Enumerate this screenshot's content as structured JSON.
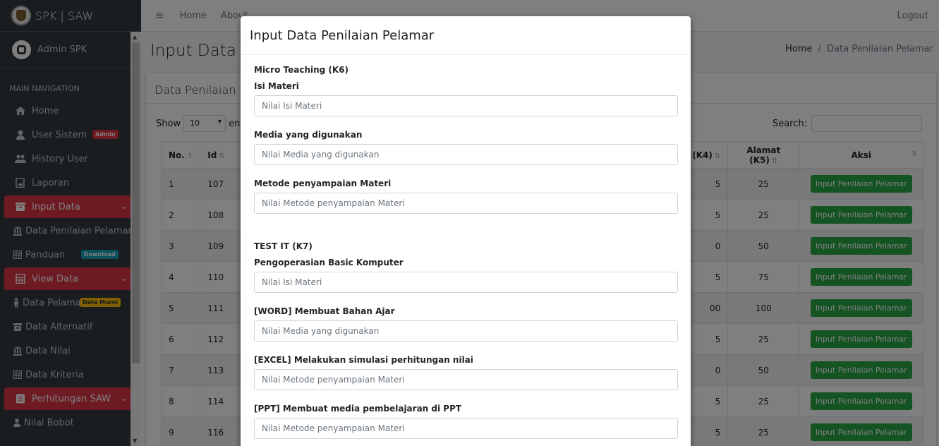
{
  "brand": "SPK | SAW",
  "user": "Admin SPK",
  "nav_header": "MAIN NAVIGATION",
  "nav": {
    "home": "Home",
    "user_sistem": "User Sistem",
    "user_sistem_badge": "Admin",
    "history_user": "History User",
    "laporan": "Laporan",
    "input_data": "Input Data",
    "data_penilaian": "Data Penilaian Pelamar",
    "panduan": "Panduan",
    "panduan_badge": "Download",
    "view_data": "View Data",
    "data_pelamar": "Data Pelamar",
    "data_pelamar_badge": "Data Murni",
    "data_alternatif": "Data Alternatif",
    "data_nilai": "Data Nilai",
    "data_kriteria": "Data Kriteria",
    "perhitungan": "Perhitungan SAW",
    "nilai_bobot": "Nilai Bobot"
  },
  "topnav": {
    "home": "Home",
    "about": "About",
    "logout": "Logout"
  },
  "page": {
    "title": "Input Data",
    "breadcrumb_home": "Home",
    "breadcrumb_sep": "/",
    "breadcrumb_current": "Data Penilaian Pelamar",
    "card_title": "Data Penilaian Pelamar",
    "show_label": "Show",
    "show_value": "10",
    "entries_label": "entries",
    "search_label": "Search:"
  },
  "table": {
    "headers": {
      "no": "No.",
      "id": "Id",
      "k4": "(K4)",
      "k5": "Alamat (K5)",
      "aksi": "Aksi"
    },
    "rows": [
      {
        "no": "1",
        "id": "107",
        "k4": "5",
        "k5": "25",
        "aksi": "Input Penilaian Pelamar"
      },
      {
        "no": "2",
        "id": "108",
        "k4": "5",
        "k5": "25",
        "aksi": "Input Penilaian Pelamar"
      },
      {
        "no": "3",
        "id": "109",
        "k4": "0",
        "k5": "50",
        "aksi": "Input Penilaian Pelamar"
      },
      {
        "no": "4",
        "id": "110",
        "k4": "5",
        "k5": "75",
        "aksi": "Input Penilaian Pelamar"
      },
      {
        "no": "5",
        "id": "111",
        "k4": "00",
        "k5": "100",
        "aksi": "Input Penilaian Pelamar"
      },
      {
        "no": "6",
        "id": "112",
        "k4": "5",
        "k5": "25",
        "aksi": "Input Penilaian Pelamar"
      },
      {
        "no": "7",
        "id": "113",
        "k4": "0",
        "k5": "50",
        "aksi": "Input Penilaian Pelamar"
      },
      {
        "no": "8",
        "id": "114",
        "k4": "5",
        "k5": "25",
        "aksi": "Input Penilaian Pelamar"
      },
      {
        "no": "9",
        "id": "116",
        "k4": "5",
        "k5": "25",
        "aksi": "Input Penilaian Pelamar"
      }
    ]
  },
  "modal": {
    "title": "Input Data Penilaian Pelamar",
    "section1": "Micro Teaching (K6)",
    "s1_fields": [
      {
        "label": "Isi Materi",
        "placeholder": "Nilai Isi Materi"
      },
      {
        "label": "Media yang digunakan",
        "placeholder": "Nilai Media yang digunakan"
      },
      {
        "label": "Metode penyampaian Materi",
        "placeholder": "Nilai Metode penyampaian Materi"
      }
    ],
    "section2": "TEST IT (K7)",
    "s2_fields": [
      {
        "label": "Pengoperasian Basic Komputer",
        "placeholder": "Nilai Isi Materi"
      },
      {
        "label": "[WORD] Membuat Bahan Ajar",
        "placeholder": "Nilai Media yang digunakan"
      },
      {
        "label": "[EXCEL] Melakukan simulasi perhitungan nilai",
        "placeholder": "Nilai Metode penyampaian Materi"
      },
      {
        "label": "[PPT] Membuat media pembelajaran di PPT",
        "placeholder": "Nilai Metode penyampaian Materi"
      }
    ]
  }
}
